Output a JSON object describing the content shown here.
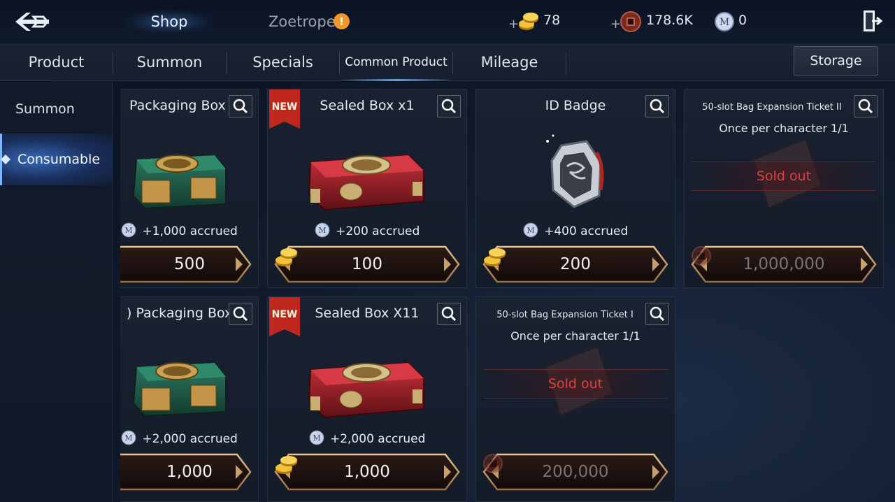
{
  "topbar": {
    "tabs": {
      "shop": "Shop",
      "zoetrope": "Zoetrope"
    },
    "alert_symbol": "!",
    "currencies": [
      {
        "icon": "gold-coin-icon",
        "plus": "+",
        "value": "78"
      },
      {
        "icon": "copper-coin-icon",
        "plus": "+",
        "value": "178.6K"
      },
      {
        "icon": "mileage-coin-icon",
        "value": "0"
      }
    ]
  },
  "tabs": {
    "items": [
      "Product",
      "Summon",
      "Specials",
      "Common Product",
      "Mileage"
    ],
    "active": "Common Product",
    "storage_label": "Storage"
  },
  "sidebar": {
    "items": [
      "Summon",
      "Consumable"
    ],
    "active": "Consumable"
  },
  "products": [
    {
      "title": "Packaging Box",
      "accrued": "+1,000 accrued",
      "price": "500",
      "currency": "gold",
      "new": false,
      "sold_out": false
    },
    {
      "title": "Sealed Box x1",
      "accrued": "+200 accrued",
      "price": "100",
      "currency": "gold",
      "new": true,
      "badge": "NEW",
      "sold_out": false
    },
    {
      "title": "ID Badge",
      "accrued": "+400 accrued",
      "price": "200",
      "currency": "gold",
      "new": false,
      "sold_out": false
    },
    {
      "title": "50-slot Bag Expansion Ticket II",
      "subtitle": "Once per character 1/1",
      "status": "Sold out",
      "price": "1,000,000",
      "currency": "copper",
      "new": false,
      "sold_out": true
    },
    {
      "title": ") Packaging Box",
      "accrued": "+2,000 accrued",
      "price": "1,000",
      "currency": "gold",
      "new": false,
      "sold_out": false
    },
    {
      "title": "Sealed Box X11",
      "accrued": "+2,000 accrued",
      "price": "1,000",
      "currency": "gold",
      "new": true,
      "badge": "NEW",
      "sold_out": false
    },
    {
      "title": "50-slot Bag Expansion Ticket I",
      "subtitle": "Once per character 1/1",
      "status": "Sold out",
      "price": "200,000",
      "currency": "copper",
      "new": false,
      "sold_out": true
    }
  ],
  "colors": {
    "accent_blue": "#5aa0ff",
    "sold_out_red": "#d8433f",
    "new_badge_red": "#c0281f",
    "price_frame_gold": "#c9a06a"
  }
}
